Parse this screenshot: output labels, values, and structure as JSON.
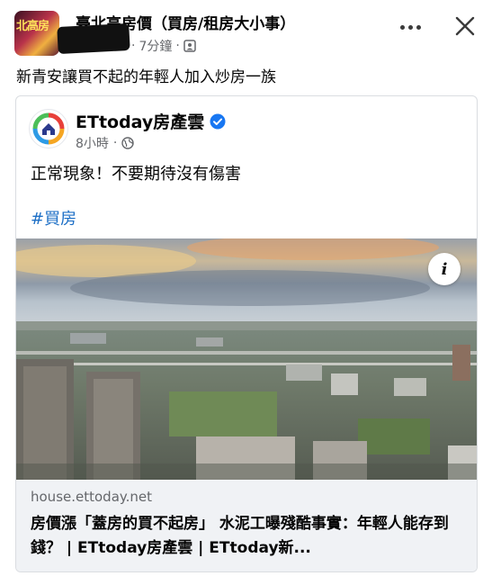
{
  "group": {
    "avatar_text": "北高房",
    "name": "臺北高房價（買房/租房大小事）",
    "time": "7分鐘",
    "dot": "·"
  },
  "post": {
    "text": "新青安讓買不起的年輕人加入炒房一族"
  },
  "shared": {
    "page_name": "ETtoday房產雲",
    "time": "8小時",
    "dot": "·",
    "text": "正常現象！不要期待沒有傷害",
    "hashtag": "#買房",
    "info_glyph": "i"
  },
  "link": {
    "domain": "house.ettoday.net",
    "headline": "房價漲「蓋房的買不起房」 水泥工曝殘酷事實：年輕人能存到錢？ | ETtoday房產雲 | ETtoday新..."
  },
  "icons": {
    "more": "more-horizontal-icon",
    "close": "close-icon",
    "privacy_group": "group-privacy-icon",
    "privacy_public": "globe-icon",
    "verified": "verified-badge-icon",
    "info": "info-icon"
  },
  "colors": {
    "hashtag": "#1d6fc6",
    "verified": "#1877f2",
    "meta_text": "#65676b",
    "link_box_bg": "#f0f2f5"
  }
}
